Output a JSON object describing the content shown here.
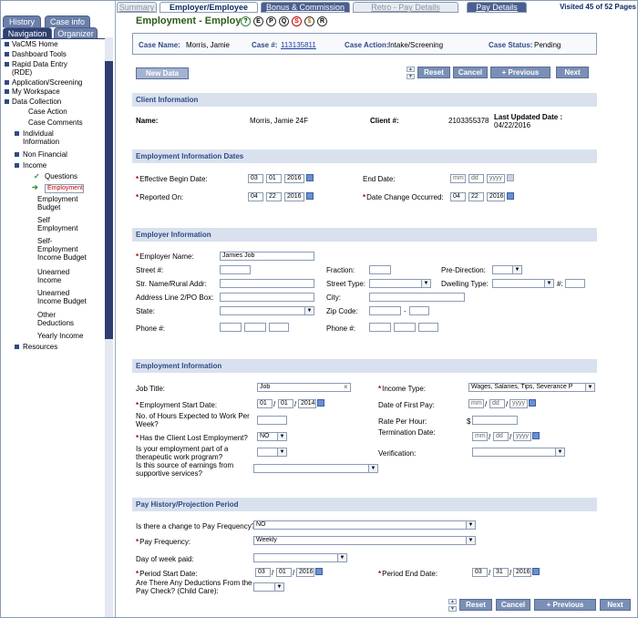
{
  "sidebar": {
    "tabs": [
      "History",
      "Case info",
      "Navigation",
      "Organizer"
    ],
    "tree": {
      "home": "VaCMS Home",
      "dashboard": "Dashboard Tools",
      "rde": "Rapid Data Entry (RDE)",
      "app": "Application/Screening",
      "workspace": "My Workspace",
      "dc": "Data Collection",
      "case_action": "Case Action",
      "case_comments": "Case Comments",
      "individual_info": "Individual Information",
      "non_financial": "Non Financial",
      "income": "Income",
      "questions": "Questions",
      "employment": "Employment",
      "employment_budget": "Employment Budget",
      "self_employment": "Self Employment",
      "self_employment_income_budget": "Self-Employment Income Budget",
      "unearned_income": "Unearned Income",
      "unearned_income_budget": "Unearned Income Budget",
      "other_deductions": "Other Deductions",
      "yearly_income": "Yearly Income",
      "resources": "Resources"
    }
  },
  "top_tabs": [
    "Summary",
    "Employer/Employee",
    "Bonus & Commission",
    "Retro - Pay Details",
    "Pay Details"
  ],
  "visited": "Visited 45 of 52 Pages",
  "page_title": "Employment - Employer",
  "header_icons": [
    "?",
    "E",
    "P",
    "Q",
    "S",
    "$",
    "R"
  ],
  "case": {
    "name_label": "Case Name:",
    "name": "Morris, Jamie",
    "num_label": "Case #:",
    "num": "113135811",
    "action_label": "Case Action:",
    "action": "Intake/Screening",
    "status_label": "Case Status:",
    "status": "Pending"
  },
  "buttons": {
    "new_data": "New Data",
    "reset": "Reset",
    "cancel": "Cancel",
    "previous": "+ Previous",
    "next": "Next"
  },
  "client": {
    "section": "Client Information",
    "name_label": "Name:",
    "name": "Morris, Jamie 24F",
    "client_label": "Client #:",
    "client_num": "2103355378",
    "updated_label": "Last Updated Date :",
    "updated": "04/22/2016"
  },
  "dates": {
    "section": "Employment Information Dates",
    "effective_label": "Effective Begin Date:",
    "effective": [
      "03",
      "01",
      "2016"
    ],
    "end_label": "End Date:",
    "end": [
      "mm",
      "dd",
      "yyyy"
    ],
    "reported_label": "Reported On:",
    "reported": [
      "04",
      "22",
      "2016"
    ],
    "change_label": "Date Change Occurred:",
    "change": [
      "04",
      "22",
      "2016"
    ]
  },
  "employer": {
    "section": "Employer Information",
    "name_label": "Employer Name:",
    "name": "Jamies Job",
    "street_label": "Street #:",
    "fraction_label": "Fraction:",
    "predir_label": "Pre-Direction:",
    "str_name_label": "Str. Name/Rural Addr:",
    "street_type_label": "Street Type:",
    "dwelling_label": "Dwelling Type:",
    "hash_label": "#:",
    "addr2_label": "Address Line 2/PO Box:",
    "city_label": "City:",
    "state_label": "State:",
    "zip_label": "Zip Code:",
    "zip_dash": "-",
    "phone_label": "Phone #:",
    "phone2_label": "Phone #:"
  },
  "employment": {
    "section": "Employment Information",
    "job_label": "Job Title:",
    "job": "Job",
    "clear": "×",
    "income_type_label": "Income Type:",
    "income_type": "Wages, Salaries, Tips, Severance P",
    "start_label": "Employment Start Date:",
    "start": [
      "01",
      "01",
      "2014"
    ],
    "first_pay_label": "Date of First Pay:",
    "first_pay": [
      "mm",
      "dd",
      "yyyy"
    ],
    "hours_label": "No. of Hours Expected to Work Per Week?",
    "rate_label": "Rate Per Hour:",
    "rate_prefix": "$",
    "lost_label": "Has the Client Lost Employment?",
    "lost": "NO",
    "term_label": "Termination Date:",
    "term": [
      "mm",
      "dd",
      "yyyy"
    ],
    "therapeutic_label": "Is your employment part of a therapeutic work program?",
    "verification_label": "Verification:",
    "supportive_label": "Is this source of earnings from supportive services?"
  },
  "pay": {
    "section": "Pay History/Projection Period",
    "change_label": "Is there a change to Pay Frequency?",
    "change": "NO",
    "freq_label": "Pay Frequency:",
    "freq": "Weekly",
    "dow_label": "Day of week paid:",
    "start_label": "Period Start Date:",
    "start": [
      "03",
      "01",
      "2016"
    ],
    "end_label": "Period End Date:",
    "end": [
      "03",
      "31",
      "2016"
    ],
    "deductions_label": "Are There Any Deductions From the Pay Check? (Child Care):"
  }
}
